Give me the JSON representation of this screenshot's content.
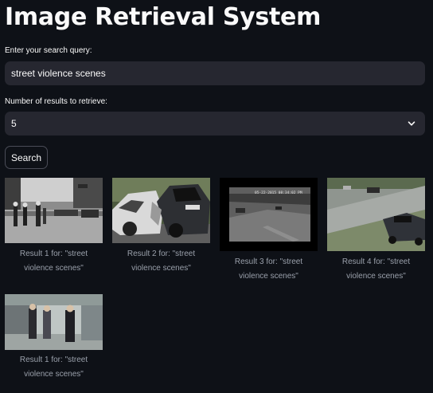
{
  "title": "Image Retrieval System",
  "query": {
    "label": "Enter your search query:",
    "value": "street violence scenes"
  },
  "num_results": {
    "label": "Number of results to retrieve:",
    "value": "5"
  },
  "search_button": "Search",
  "results": [
    {
      "caption_line1": "Result 1 for: \"street",
      "caption_line2": "violence scenes\""
    },
    {
      "caption_line1": "Result 2 for: \"street",
      "caption_line2": "violence scenes\""
    },
    {
      "caption_line1": "Result 3 for: \"street",
      "caption_line2": "violence scenes\"",
      "overlay_text": "05-22-2015 08:34:02 PM"
    },
    {
      "caption_line1": "Result 4 for: \"street",
      "caption_line2": "violence scenes\""
    },
    {
      "caption_line1": "Result 1 for: \"street",
      "caption_line2": "violence scenes\""
    }
  ],
  "icons": {
    "select_chevron": "chevron-down-icon"
  },
  "colors": {
    "background": "#0e1117",
    "input_bg": "#262730",
    "text": "#fafafa",
    "caption": "#9aa0ab"
  }
}
